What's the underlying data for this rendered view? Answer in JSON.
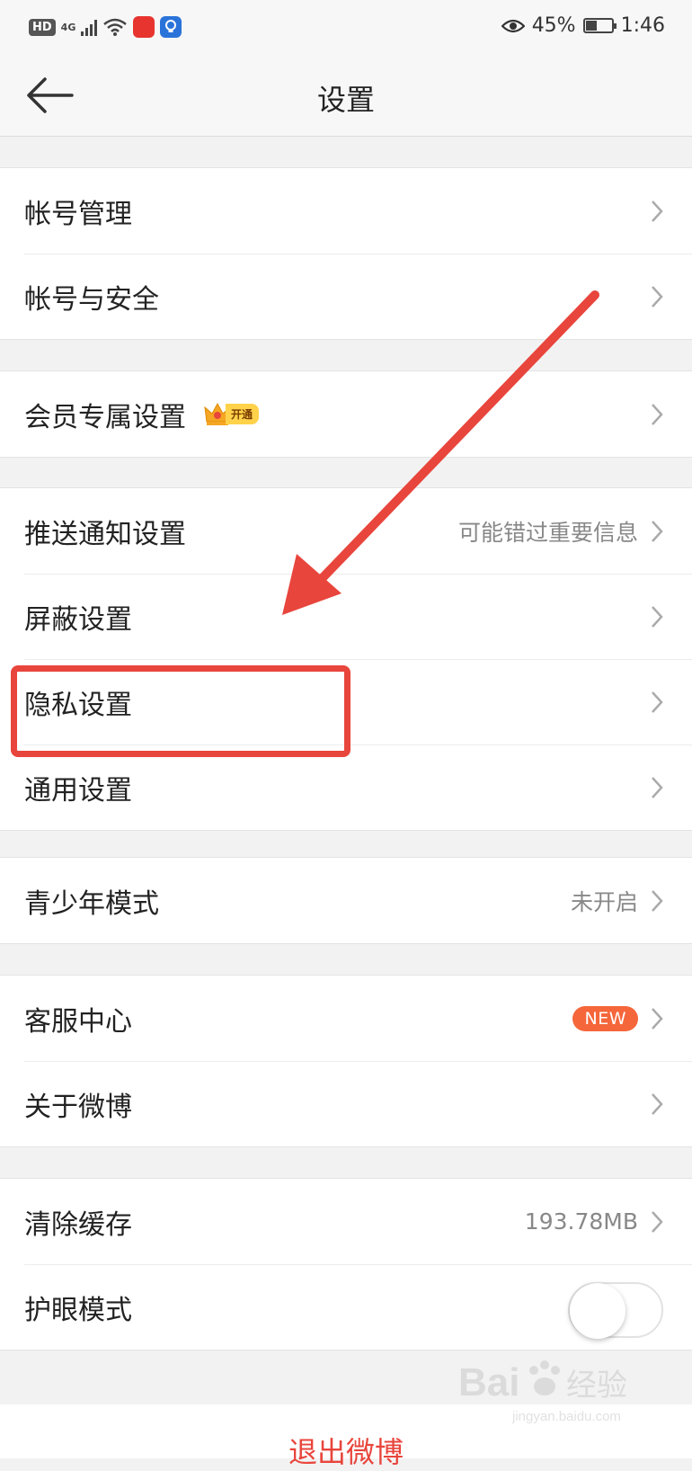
{
  "status_bar": {
    "hd": "HD",
    "network": "4G",
    "battery": "45%",
    "battery_level": 0.45,
    "time": "1:46"
  },
  "nav": {
    "title": "设置"
  },
  "groups": [
    {
      "items": [
        {
          "label": "帐号管理"
        },
        {
          "label": "帐号与安全"
        }
      ]
    },
    {
      "items": [
        {
          "label": "会员专属设置",
          "badge": "开通"
        }
      ]
    },
    {
      "items": [
        {
          "label": "推送通知设置",
          "value": "可能错过重要信息"
        },
        {
          "label": "屏蔽设置"
        },
        {
          "label": "隐私设置"
        },
        {
          "label": "通用设置"
        }
      ]
    },
    {
      "items": [
        {
          "label": "青少年模式",
          "value": "未开启"
        }
      ]
    },
    {
      "items": [
        {
          "label": "客服中心",
          "badge": "NEW"
        },
        {
          "label": "关于微博"
        }
      ]
    },
    {
      "items": [
        {
          "label": "清除缓存",
          "value": "193.78MB"
        },
        {
          "label": "护眼模式",
          "toggle_on": false
        }
      ]
    }
  ],
  "logout": {
    "label": "退出微博"
  },
  "watermark": {
    "brand": "Bai",
    "brand2": "经验",
    "url": "jingyan.baidu.com"
  },
  "colors": {
    "accent_red": "#e8453c",
    "new_badge": "#f5663a",
    "vip_gold": "#ffd24a"
  },
  "icons": [
    "back-arrow-icon",
    "chevron-right-icon",
    "crown-icon",
    "eye-icon",
    "wifi-icon",
    "signal-icon",
    "battery-icon"
  ]
}
